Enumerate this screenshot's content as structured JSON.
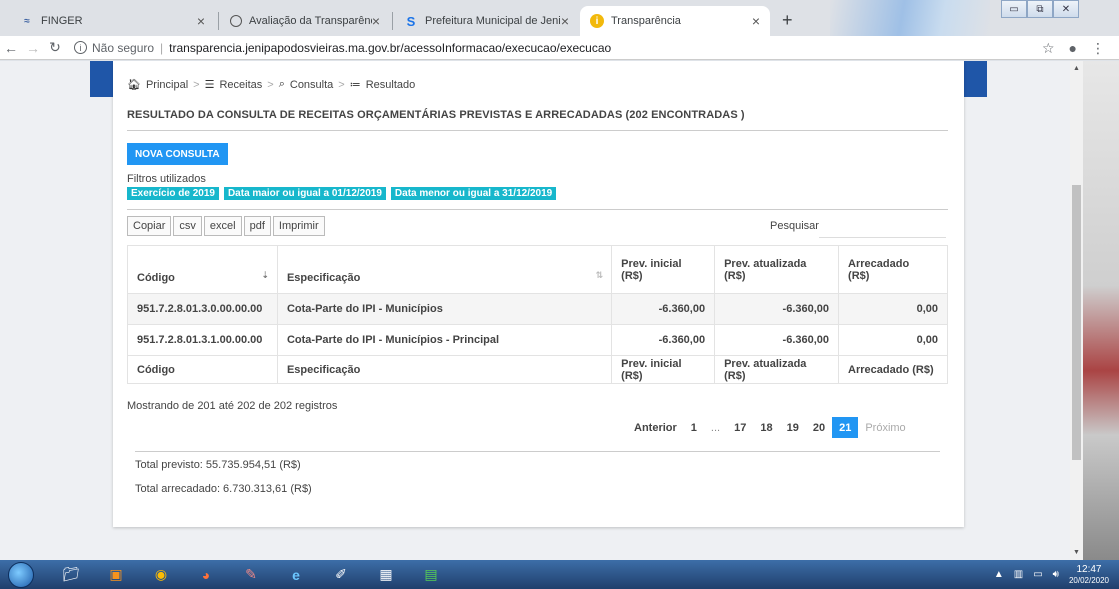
{
  "browser": {
    "tabs": [
      {
        "title": "FINGER",
        "icon": "finger-app-icon",
        "active": false
      },
      {
        "title": "Avaliação da Transparência dos I",
        "icon": "globe-icon",
        "active": false
      },
      {
        "title": "Prefeitura Municipal de Jenipapo",
        "icon": "s-logo-icon",
        "active": false
      },
      {
        "title": "Transparência",
        "icon": "info-badge-icon",
        "active": true
      }
    ],
    "security": "Não seguro",
    "url": "transparencia.jenipapodosvieiras.ma.gov.br/acessoInformacao/execucao/execucao"
  },
  "breadcrumb": [
    "Principal",
    "Receitas",
    "Consulta",
    "Resultado"
  ],
  "title": "RESULTADO DA CONSULTA DE RECEITAS ORÇAMENTÁRIAS PREVISTAS E ARRECADADAS (202 ENCONTRADAS )",
  "new_query_label": "NOVA CONSULTA",
  "filters_label": "Filtros utilizados",
  "filters": [
    "Exercício de 2019",
    "Data maior ou igual a 01/12/2019",
    "Data menor ou igual a 31/12/2019"
  ],
  "export_buttons": [
    "Copiar",
    "csv",
    "excel",
    "pdf",
    "Imprimir"
  ],
  "search_label": "Pesquisar",
  "table": {
    "headers": [
      "Código",
      "Especificação",
      "Prev. inicial (R$)",
      "Prev. atualizada (R$)",
      "Arrecadado (R$)"
    ],
    "rows": [
      [
        "951.7.2.8.01.3.0.00.00.00",
        "Cota-Parte do IPI - Municípios",
        "-6.360,00",
        "-6.360,00",
        "0,00"
      ],
      [
        "951.7.2.8.01.3.1.00.00.00",
        "Cota-Parte do IPI - Municípios - Principal",
        "-6.360,00",
        "-6.360,00",
        "0,00"
      ]
    ],
    "footer": [
      "Código",
      "Especificação",
      "Prev. inicial (R$)",
      "Prev. atualizada (R$)",
      "Arrecadado (R$)"
    ]
  },
  "showing": "Mostrando de 201 até 202 de 202 registros",
  "pagination": {
    "prev": "Anterior",
    "pages": [
      "1",
      "...",
      "17",
      "18",
      "19",
      "20",
      "21"
    ],
    "current": "21",
    "next": "Próximo"
  },
  "totals": {
    "previsto": "Total previsto: 55.735.954,51 (R$)",
    "arrecadado": "Total arrecadado: 6.730.313,61 (R$)"
  },
  "taskbar": {
    "time": "12:47",
    "date": "20/02/2020"
  },
  "colors": {
    "primary": "#2196f3",
    "chip": "#17b7cc",
    "header_band": "#1f56a8"
  }
}
